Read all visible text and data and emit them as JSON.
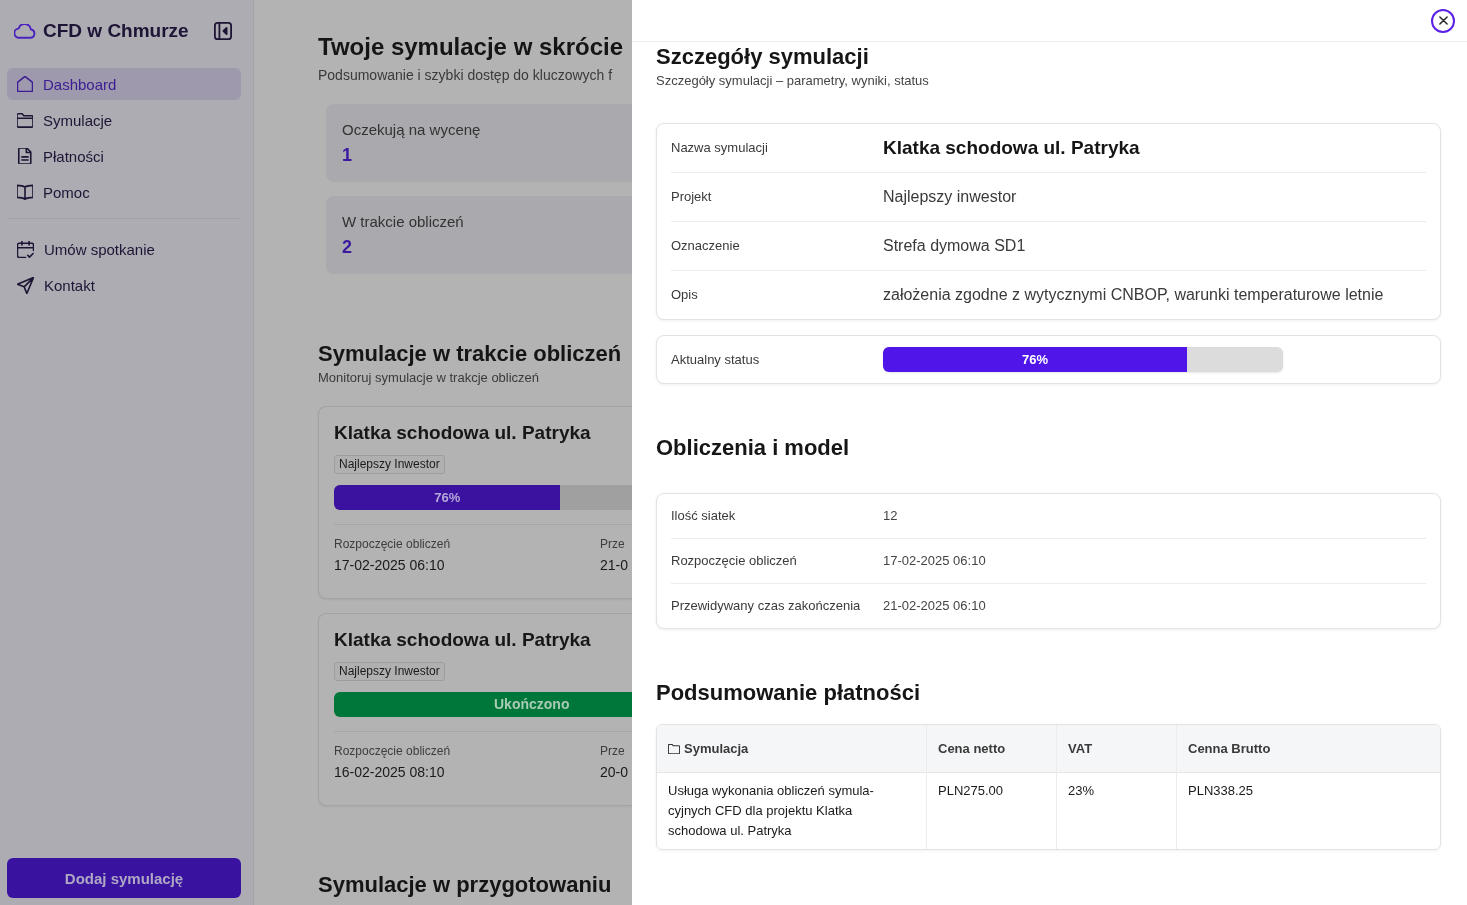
{
  "sidebar": {
    "brand": "CFD w Chmurze",
    "nav_items": [
      {
        "label": "Dashboard",
        "selected": true
      },
      {
        "label": "Symulacje",
        "selected": false
      },
      {
        "label": "Płatności",
        "selected": false
      },
      {
        "label": "Pomoc",
        "selected": false
      }
    ],
    "secondary_items": [
      {
        "label": "Umów spotkanie",
        "selected": false
      },
      {
        "label": "Kontakt",
        "selected": false
      }
    ],
    "add_button": "Dodaj symulację"
  },
  "overview": {
    "title": "Twoje symulacje w skrócie",
    "subtitle": "Podsumowanie i szybki dostęp do kluczowych f",
    "stats": [
      {
        "label": "Oczekują na wycenę",
        "value": "1"
      },
      {
        "label": "W trakcie obliczeń",
        "value": "2"
      }
    ]
  },
  "in_progress": {
    "title": "Symulacje w trakcie obliczeń",
    "subtitle": "Monitoruj symulacje w trakcje obliczeń",
    "cards": [
      {
        "title": "Klatka schodowa ul. Patryka",
        "tag": "Najlepszy Inwestor",
        "status": {
          "kind": "progress",
          "label": "76%",
          "level": 0.76
        },
        "fields": [
          {
            "label": "Rozpoczęcie obliczeń",
            "value": "17-02-2025 06:10"
          },
          {
            "label": "Prze",
            "value": "21-0"
          }
        ]
      },
      {
        "title": "Klatka schodowa ul. Patryka",
        "tag": "Najlepszy Inwestor",
        "status": {
          "kind": "completed",
          "label": "Ukończono"
        },
        "fields": [
          {
            "label": "Rozpoczęcie obliczeń",
            "value": "16-02-2025 08:10"
          },
          {
            "label": "Prze",
            "value": "20-0"
          }
        ]
      }
    ]
  },
  "in_preparation": {
    "title": "Symulacje w przygotowaniu"
  },
  "drawer": {
    "title": "Szczegóły symulacji",
    "subtitle": "Szczegóły symulacji – parametry, wyniki, status",
    "details": [
      {
        "kind": "title",
        "label": "Nazwa symulacji",
        "value": "Klatka schodowa ul. Patryka"
      },
      {
        "kind": "text",
        "label": "Projekt",
        "value": "Najlepszy inwestor"
      },
      {
        "kind": "text",
        "label": "Oznaczenie",
        "value": "Strefa dymowa SD1"
      },
      {
        "kind": "text",
        "label": "Opis",
        "value": "założenia zgodne z wytycznymi CNBOP, warunki temperaturowe letnie"
      }
    ],
    "status": {
      "label": "Aktualny status",
      "progress_label": "76%",
      "level": 0.76
    },
    "computation": {
      "title": "Obliczenia i model",
      "rows": [
        {
          "label": "Ilość siatek",
          "value": "12"
        },
        {
          "label": "Rozpoczęcie obliczeń",
          "value": "17-02-2025 06:10"
        },
        {
          "label": "Przewidywany czas zakończenia",
          "value": "21-02-2025 06:10"
        }
      ]
    },
    "payment": {
      "title": "Podsumowanie płatności",
      "columns": [
        "Symulacja",
        "Cena netto",
        "VAT",
        "Cenna Brutto"
      ],
      "rows": [
        [
          "Usługa wykonania obliczeń symula-cyjnych CFD dla projektu Klatka schodowa ul. Patryka",
          "PLN275.00",
          "23%",
          "PLN338.25"
        ]
      ]
    }
  }
}
